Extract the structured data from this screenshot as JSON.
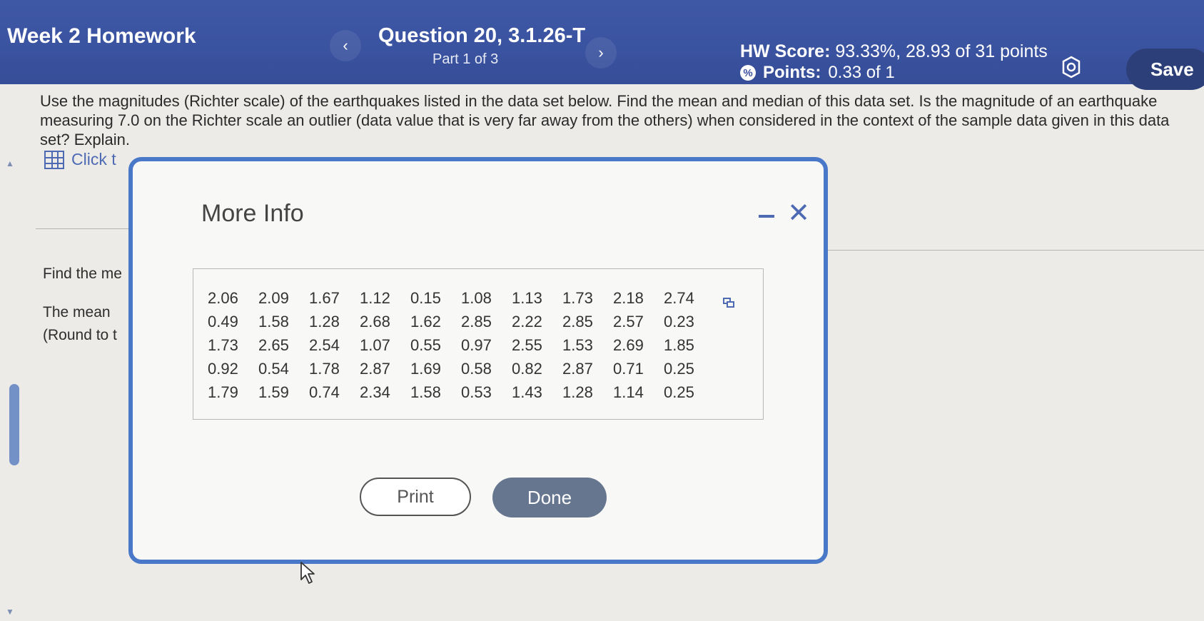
{
  "header": {
    "assignment_title": "Week 2 Homework",
    "prev_label": "‹",
    "next_label": "›",
    "question_title": "Question 20, 3.1.26-T",
    "question_part": "Part 1 of 3",
    "hw_score_label": "HW Score:",
    "hw_score_value": "93.33%, 28.93 of 31 points",
    "points_label": "Points:",
    "points_value": "0.33 of 1",
    "points_icon": "partial-credit-icon",
    "settings_icon": "gear-icon",
    "save_label": "Save"
  },
  "question": {
    "text": "Use the magnitudes (Richter scale) of the earthquakes listed in the data set below. Find the mean and median of this data set. Is the magnitude of an earthquake measuring 7.0 on the Richter scale an outlier (data value that is very far away from the others) when considered in the context of the sample data given in this data set? Explain.",
    "click_text": "Click t",
    "find_text": "Find the me",
    "mean_text": "The mean",
    "round_text": "(Round to t"
  },
  "modal": {
    "title": "More Info",
    "minimize_icon": "minimize-icon",
    "close_icon": "close-icon",
    "data_rows": [
      [
        "2.06",
        "2.09",
        "1.67",
        "1.12",
        "0.15",
        "1.08",
        "1.13",
        "1.73",
        "2.18",
        "2.74"
      ],
      [
        "0.49",
        "1.58",
        "1.28",
        "2.68",
        "1.62",
        "2.85",
        "2.22",
        "2.85",
        "2.57",
        "0.23"
      ],
      [
        "1.73",
        "2.65",
        "2.54",
        "1.07",
        "0.55",
        "0.97",
        "2.55",
        "1.53",
        "2.69",
        "1.85"
      ],
      [
        "0.92",
        "0.54",
        "1.78",
        "2.87",
        "1.69",
        "0.58",
        "0.82",
        "2.87",
        "0.71",
        "0.25"
      ],
      [
        "1.79",
        "1.59",
        "0.74",
        "2.34",
        "1.58",
        "0.53",
        "1.43",
        "1.28",
        "1.14",
        "0.25"
      ]
    ],
    "print_label": "Print",
    "done_label": "Done"
  },
  "colors": {
    "header_bg": "#3a53a0",
    "accent": "#4d6ab3",
    "modal_border": "#4a78c8",
    "done_bg": "#66768e",
    "save_bg": "#2d3f78"
  }
}
